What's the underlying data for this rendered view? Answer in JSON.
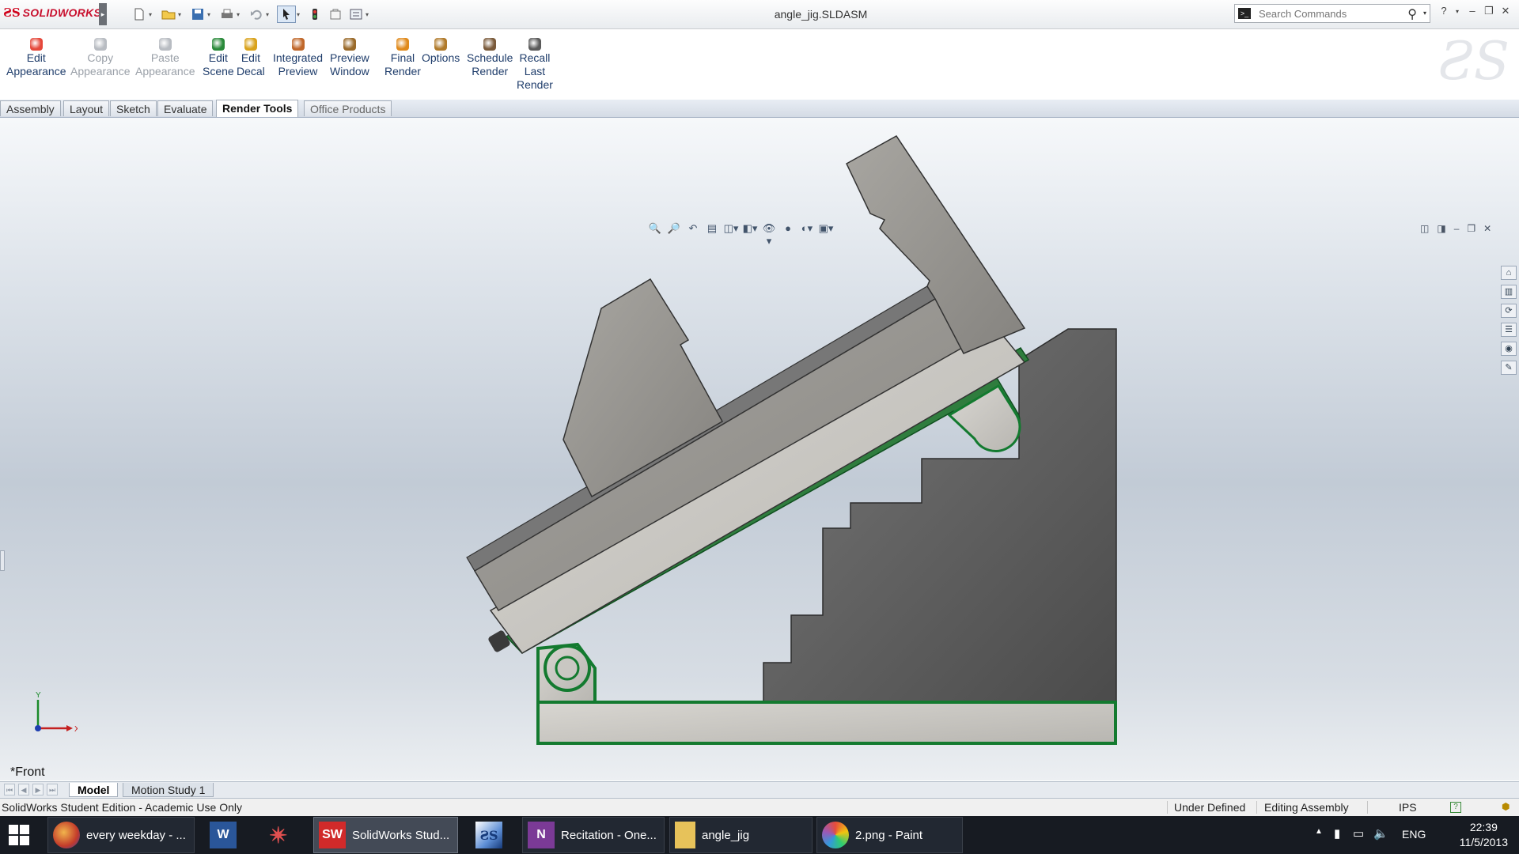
{
  "app": {
    "logo_text": "SOLIDWORKS",
    "document_title": "angle_jig.SLDASM",
    "search_placeholder": "Search Commands"
  },
  "ribbon": {
    "commands": [
      {
        "label": "Edit\nAppearance",
        "enabled": true,
        "icon": "appearance-icon"
      },
      {
        "label": "Copy\nAppearance",
        "enabled": false,
        "icon": "copy-appearance-icon"
      },
      {
        "label": "Paste\nAppearance",
        "enabled": false,
        "icon": "paste-appearance-icon"
      },
      {
        "label": "Edit\nScene",
        "enabled": true,
        "icon": "scene-icon"
      },
      {
        "label": "Edit\nDecal",
        "enabled": true,
        "icon": "decal-icon"
      },
      {
        "label": "Integrated\nPreview",
        "enabled": true,
        "icon": "integrated-preview-icon"
      },
      {
        "label": "Preview\nWindow",
        "enabled": true,
        "icon": "preview-window-icon"
      },
      {
        "label": "Final\nRender",
        "enabled": true,
        "icon": "final-render-icon"
      },
      {
        "label": "Options",
        "enabled": true,
        "icon": "options-icon"
      },
      {
        "label": "Schedule\nRender",
        "enabled": true,
        "icon": "schedule-render-icon"
      },
      {
        "label": "Recall\nLast\nRender",
        "enabled": true,
        "icon": "recall-render-icon"
      }
    ]
  },
  "tabs": [
    {
      "label": "Assembly",
      "active": false
    },
    {
      "label": "Layout",
      "active": false
    },
    {
      "label": "Sketch",
      "active": false
    },
    {
      "label": "Evaluate",
      "active": false
    },
    {
      "label": "Render Tools",
      "active": true
    },
    {
      "label": "Office Products",
      "active": false
    }
  ],
  "viewport": {
    "view_name": "*Front",
    "triad": {
      "y_label": "Y",
      "x_label": "X"
    }
  },
  "model_tabs": [
    {
      "label": "Model",
      "active": true
    },
    {
      "label": "Motion Study 1",
      "active": false
    }
  ],
  "status": {
    "left": "SolidWorks Student Edition - Academic Use Only",
    "definition": "Under Defined",
    "mode": "Editing Assembly",
    "units": "IPS"
  },
  "taskbar": {
    "items": [
      {
        "label": "every weekday - ...",
        "icon": "firefox-icon",
        "active": false
      },
      {
        "label": "",
        "icon": "word-icon",
        "active": false
      },
      {
        "label": "",
        "icon": "app-star-icon",
        "active": false
      },
      {
        "label": "SolidWorks Stud...",
        "icon": "solidworks-icon",
        "active": true
      },
      {
        "label": "",
        "icon": "ds-app-icon",
        "active": false
      },
      {
        "label": "Recitation - One...",
        "icon": "onenote-icon",
        "active": false
      },
      {
        "label": "angle_jig",
        "icon": "folder-icon",
        "active": false
      },
      {
        "label": "2.png - Paint",
        "icon": "paint-icon",
        "active": false
      }
    ],
    "language": "ENG",
    "time": "22:39",
    "date": "11/5/2013"
  },
  "colors": {
    "accent_green": "#1f8a3b",
    "part_gray_light": "#c9c7c2",
    "part_gray_dark": "#5b5b5b",
    "taskbar": "#171b22"
  }
}
